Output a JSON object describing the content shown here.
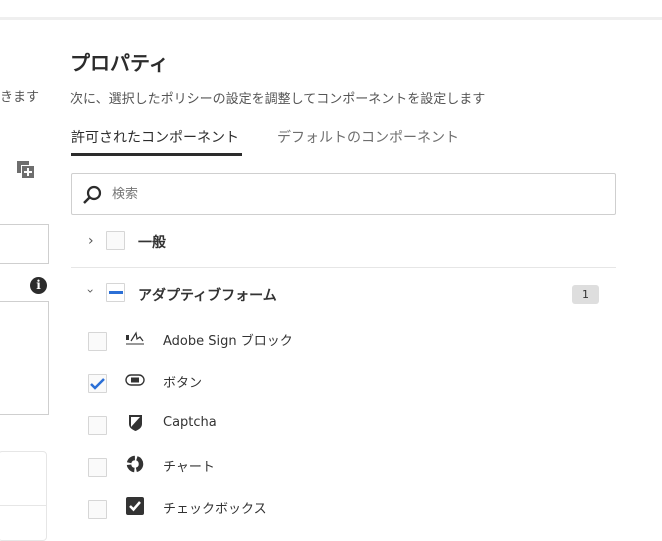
{
  "left_panel": {
    "desc_fragment": "きます"
  },
  "properties": {
    "title": "プロパティ",
    "description": "次に、選択したポリシーの設定を調整してコンポーネントを設定します",
    "tabs": [
      {
        "label": "許可されたコンポーネント",
        "active": true
      },
      {
        "label": "デフォルトのコンポーネント",
        "active": false
      }
    ],
    "search": {
      "placeholder": "検索",
      "value": ""
    },
    "groups": [
      {
        "label": "一般",
        "expanded": false
      },
      {
        "label": "アダプティブフォーム",
        "expanded": true,
        "count": "1"
      }
    ],
    "items": [
      {
        "label": "Adobe Sign ブロック",
        "icon": "signature-icon",
        "checked": false
      },
      {
        "label": "ボタン",
        "icon": "button-icon",
        "checked": true
      },
      {
        "label": "Captcha",
        "icon": "shield-icon",
        "checked": false
      },
      {
        "label": "チャート",
        "icon": "chart-icon",
        "checked": false
      },
      {
        "label": "チェックボックス",
        "icon": "checkbox-icon",
        "checked": false
      }
    ]
  },
  "colors": {
    "accent": "#2b6fd6"
  }
}
